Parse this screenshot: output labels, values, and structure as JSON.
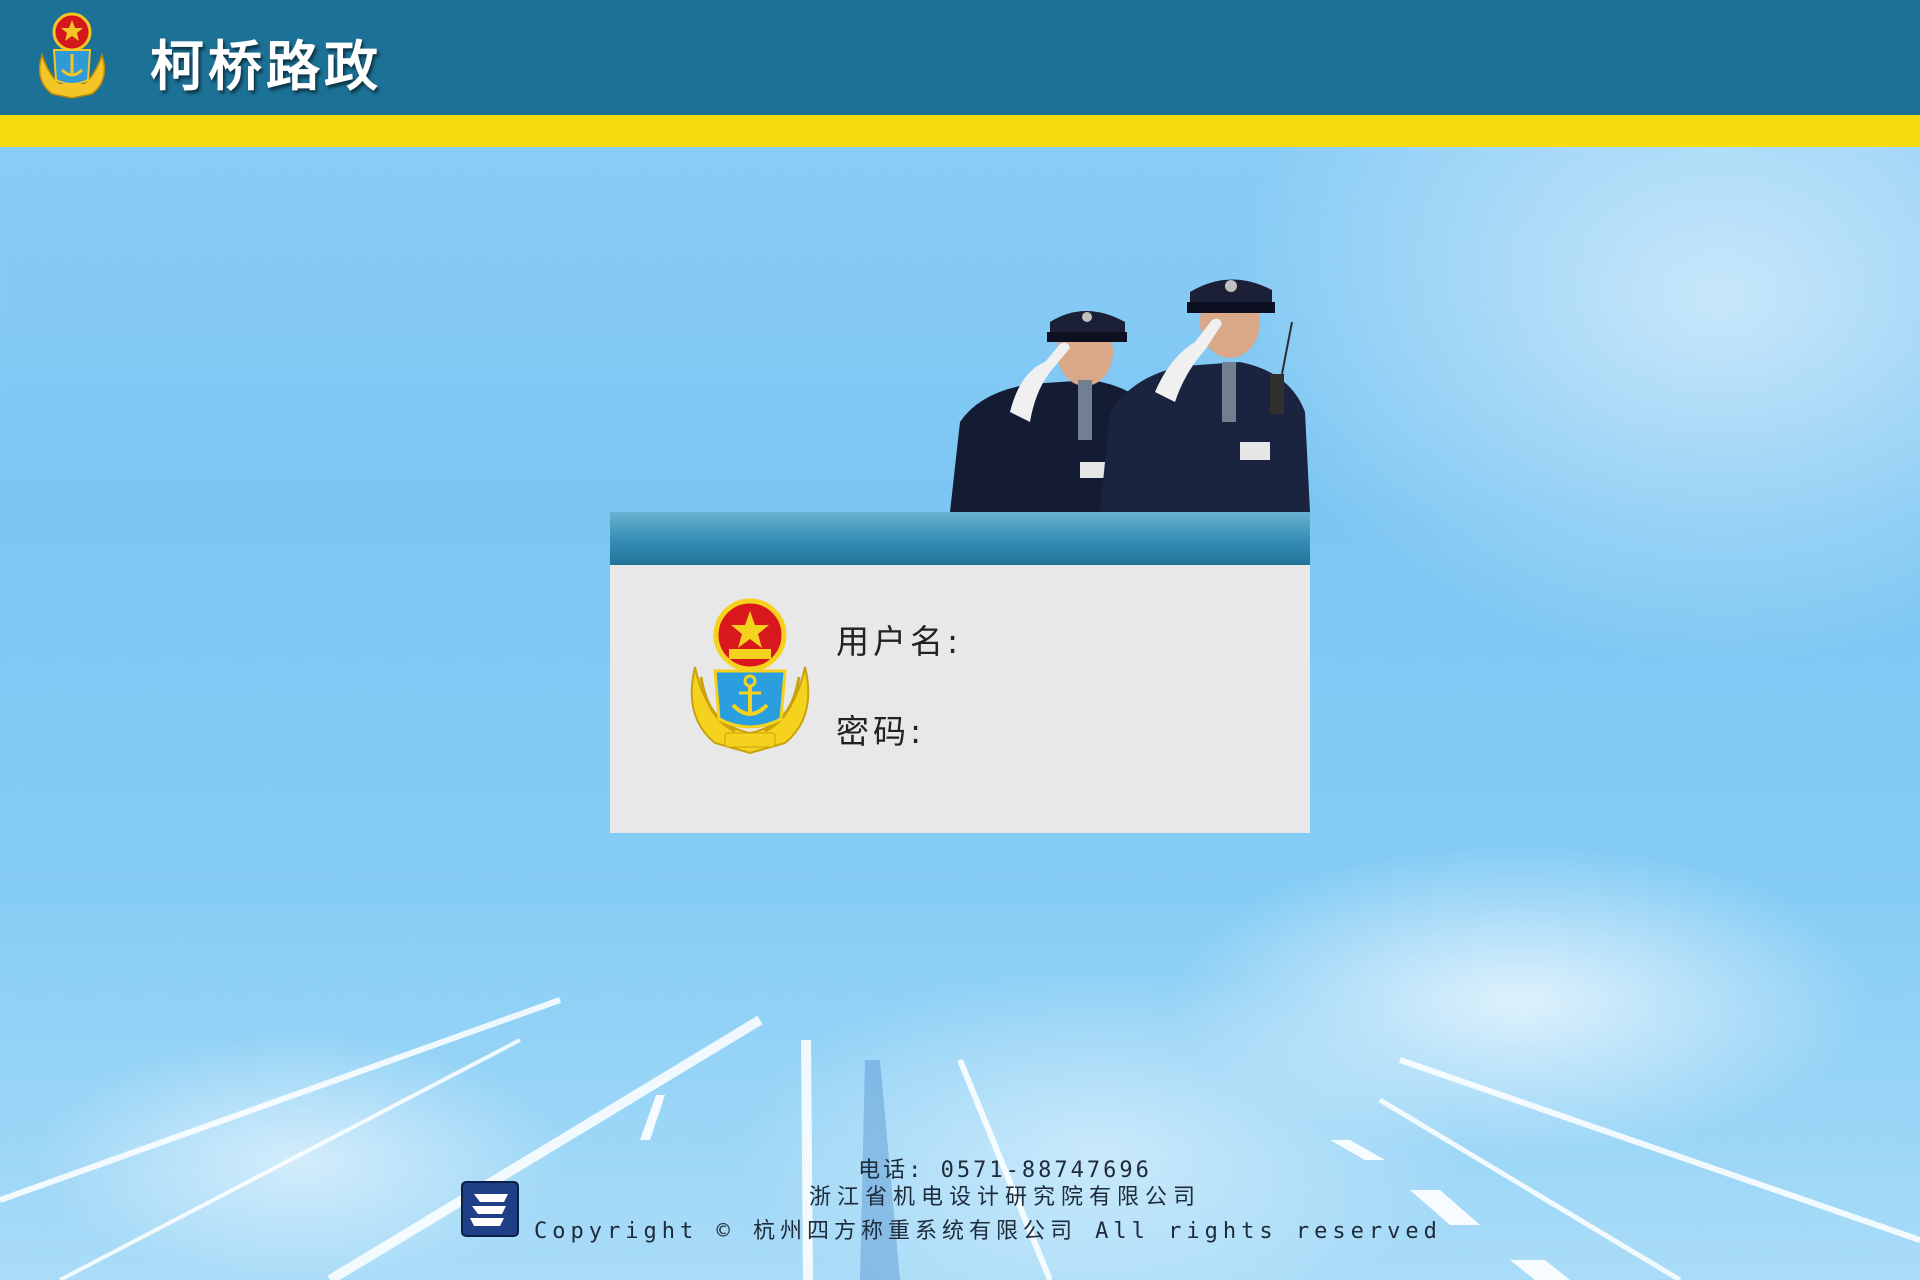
{
  "header": {
    "title": "柯桥路政",
    "emblem_icon": "road-administration-emblem-icon",
    "background_color": "#1c7196",
    "stripe_color": "#f6dc0c"
  },
  "login": {
    "username_label": "用户名:",
    "password_label": "密码:",
    "username_value": "",
    "password_value": "",
    "emblem_icon": "road-administration-emblem-icon",
    "illustration": "saluting-officers-illustration"
  },
  "footer": {
    "phone": "电话: 0571-88747696",
    "company": "浙江省机电设计研究院有限公司",
    "copyright": "Copyright © 杭州四方称重系统有限公司 All rights reserved",
    "logo_icon": "company-logo-icon"
  }
}
